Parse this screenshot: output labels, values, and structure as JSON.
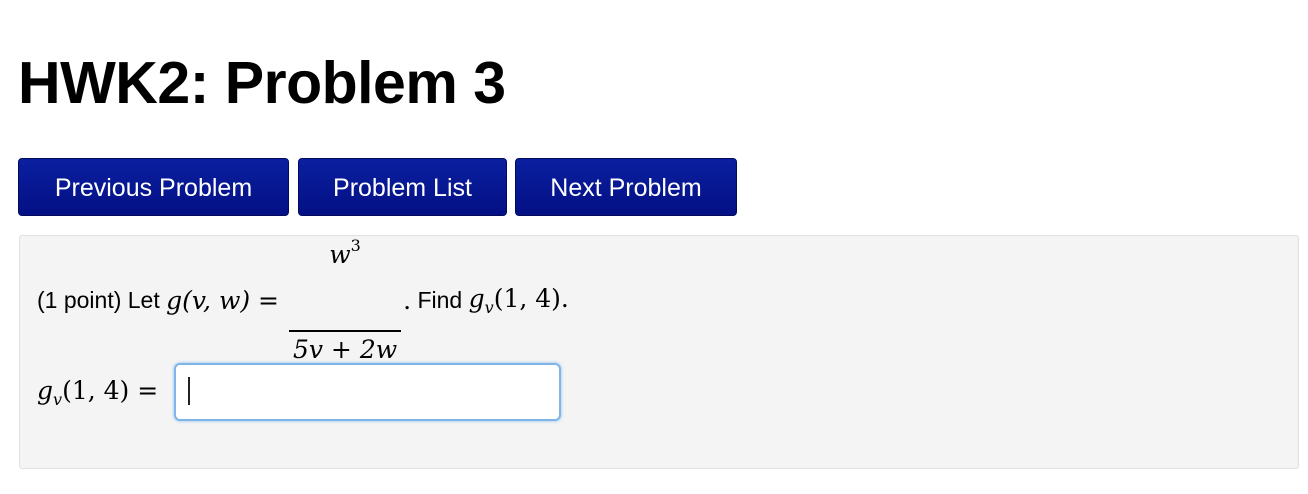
{
  "page": {
    "title": "HWK2: Problem 3"
  },
  "nav": {
    "previous_label": "Previous Problem",
    "list_label": "Problem List",
    "next_label": "Next Problem"
  },
  "problem": {
    "points_text": "(1 point) Let ",
    "func_lhs": "g(v, w) = ",
    "numerator": "w",
    "numerator_exp": "3",
    "denominator": "5v + 2w",
    "period": ".",
    "find_text": " Find ",
    "target": "g",
    "target_sub": "v",
    "target_args": "(1, 4).",
    "answer_label_func": "g",
    "answer_label_sub": "v",
    "answer_label_rest": "(1, 4) =",
    "answer_value": "",
    "answer_placeholder": ""
  },
  "colors": {
    "button_bg": "#06148c",
    "panel_bg": "#f4f4f4",
    "input_focus_border": "#7fb6ea"
  }
}
